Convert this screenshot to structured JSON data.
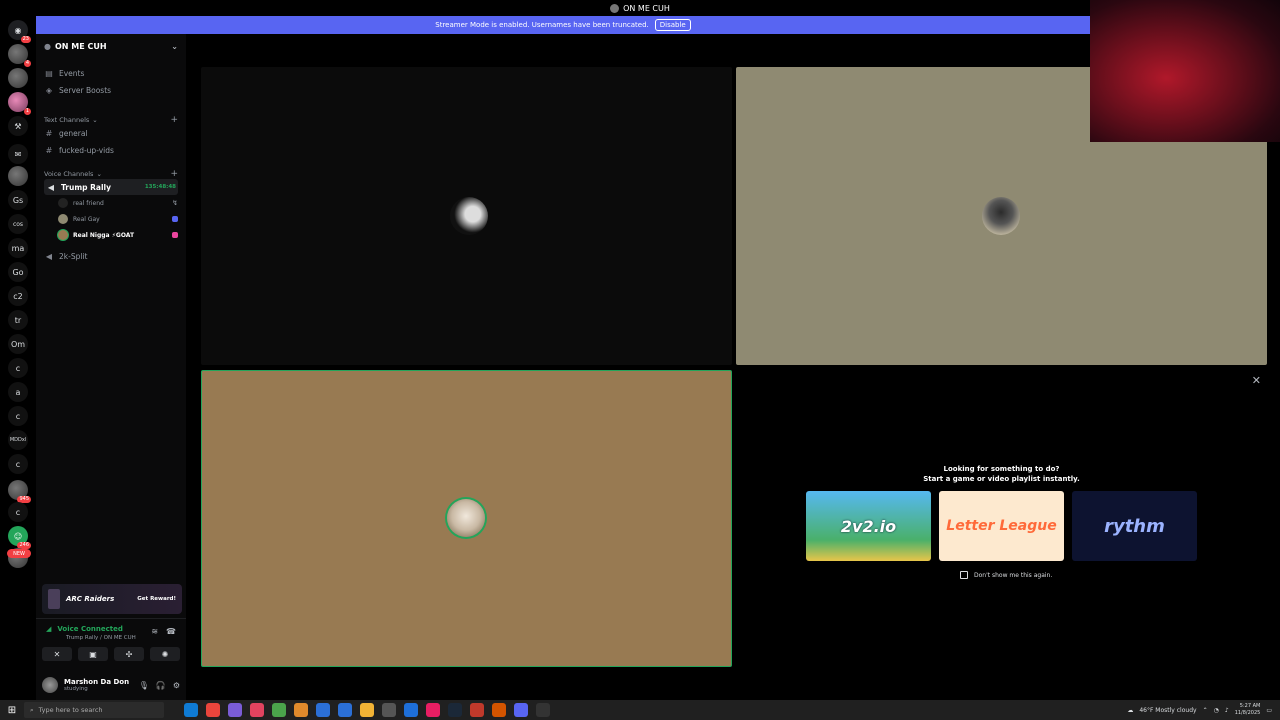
{
  "window": {
    "title": "ON ME CUH"
  },
  "banner": {
    "text": "Streamer Mode is enabled. Usernames have been truncated.",
    "disable_label": "Disable"
  },
  "rail": {
    "servers": [
      "Gs",
      "cos",
      "ma",
      "Go",
      "c2",
      "tr",
      "Om",
      "c",
      "a",
      "c",
      "MDDxl",
      "c",
      "c"
    ],
    "badges": [
      "23",
      "4",
      "1",
      "945",
      "246"
    ],
    "new_label": "NEW"
  },
  "guild": {
    "name": "ON ME CUH"
  },
  "sidebar": {
    "events": "Events",
    "boosts": "Server Boosts",
    "text_category": "Text Channels",
    "text_channels": [
      "general",
      "fucked-up-vids"
    ],
    "voice_category": "Voice Channels",
    "voice_channel": {
      "name": "Trump Rally",
      "timer": "135:48:48"
    },
    "voice_users": [
      "real friend",
      "Real Gay",
      "Real Nigga ⚡GOAT"
    ],
    "other_voice": "2k-Split"
  },
  "promo": {
    "brand": "ARC Raiders",
    "cta": "Get Reward!"
  },
  "voice_panel": {
    "status": "Voice Connected",
    "location": "Trump Rally / ON ME CUH"
  },
  "user": {
    "name": "Marshon Da Don",
    "status": "studying"
  },
  "activity": {
    "title_line1": "Looking for something to do?",
    "title_line2": "Start a game or video playlist instantly.",
    "games": [
      "2v2.io",
      "Letter League",
      "rythm"
    ],
    "dont_show": "Don't show me this again."
  },
  "taskbar": {
    "search_placeholder": "Type here to search",
    "weather": "46°F  Mostly cloudy",
    "time": "5:27 AM",
    "date": "11/8/2025"
  },
  "colors": {
    "blurple": "#5865f2",
    "green": "#23a55a",
    "red": "#f23f43"
  }
}
